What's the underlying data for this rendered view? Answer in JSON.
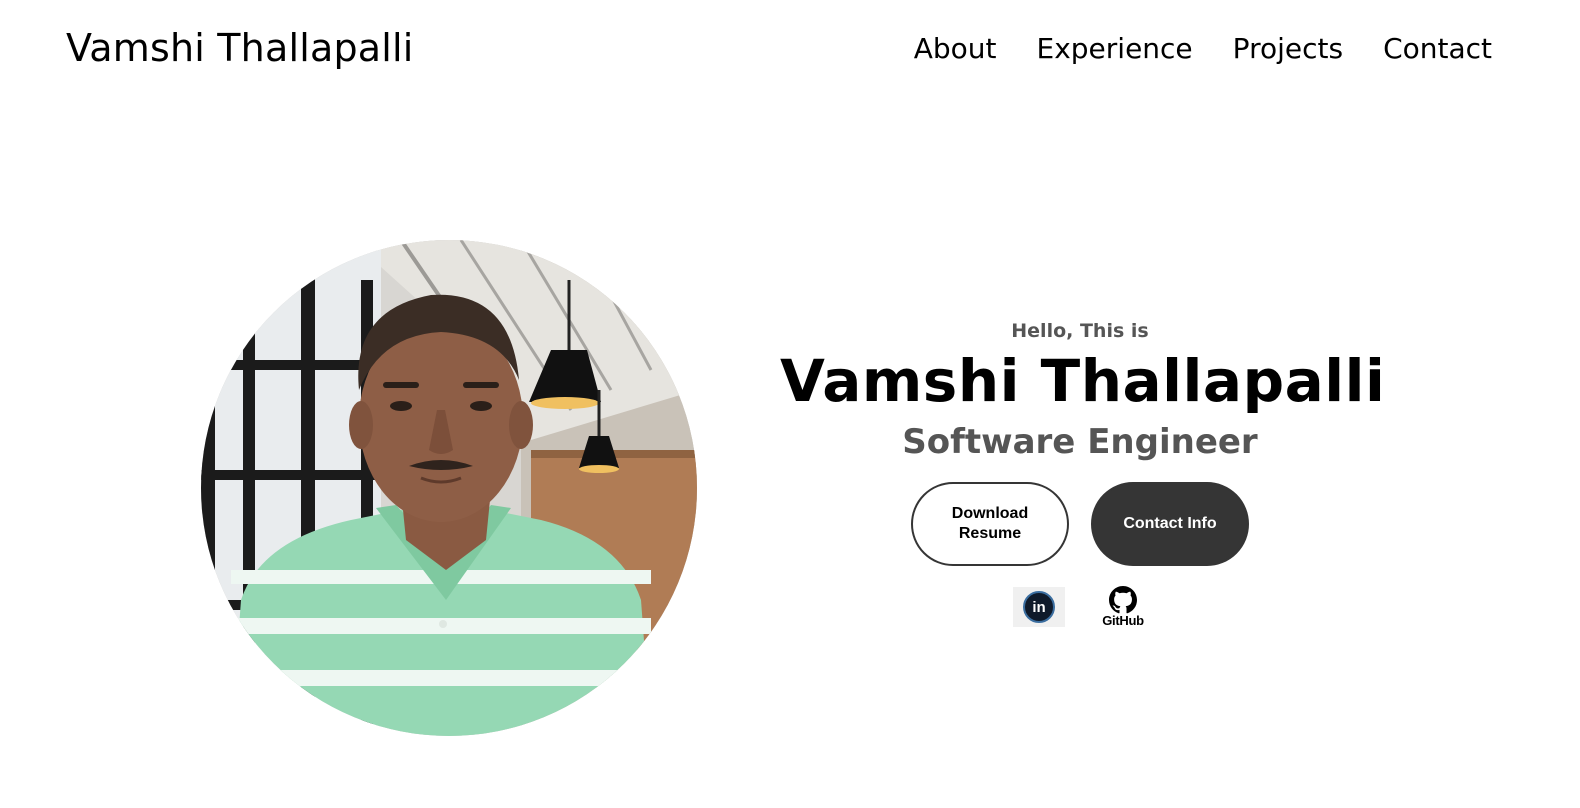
{
  "nav": {
    "logo": "Vamshi Thallapalli",
    "links": [
      {
        "label": "About"
      },
      {
        "label": "Experience"
      },
      {
        "label": "Projects"
      },
      {
        "label": "Contact"
      }
    ]
  },
  "hero": {
    "photo_alt": "Profile picture",
    "greeting": "Hello, This is",
    "name": "Vamshi Thallapalli",
    "role": "Software Engineer",
    "buttons": {
      "resume": "Download Resume",
      "contact": "Contact Info"
    },
    "socials": {
      "linkedin_icon": "linkedin-icon",
      "linkedin_text": "in",
      "github_icon": "github-icon",
      "github_text": "GitHub"
    }
  },
  "colors": {
    "text": "#000000",
    "muted": "#555555",
    "button_dark": "#353535",
    "background": "#ffffff"
  }
}
